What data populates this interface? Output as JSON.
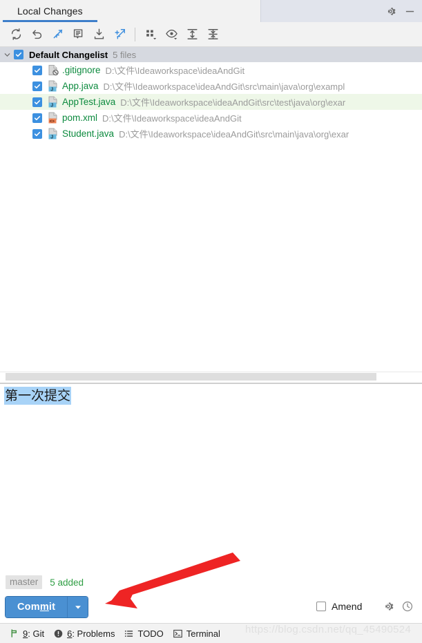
{
  "window": {
    "tab_label": "Local Changes",
    "gear_icon": "gear-icon",
    "minimize_icon": "minimize-icon",
    "accent_color": "#3d7eca"
  },
  "toolbar": {
    "buttons": [
      {
        "name": "refresh-button",
        "icon": "refresh-icon"
      },
      {
        "name": "rollback-button",
        "icon": "undo-arrow-icon"
      },
      {
        "name": "show-diff-button",
        "icon": "diff-arrow-icon"
      },
      {
        "name": "edit-message-button",
        "icon": "comment-icon"
      },
      {
        "name": "shelve-changes-button",
        "icon": "download-tray-icon"
      },
      {
        "name": "unshelve-button",
        "icon": "shelve-arrow-icon"
      },
      {
        "name": "group-by-button",
        "icon": "group-by-icon"
      },
      {
        "name": "preview-diff-button",
        "icon": "eye-icon"
      },
      {
        "name": "expand-all-button",
        "icon": "expand-all-icon"
      },
      {
        "name": "collapse-all-button",
        "icon": "collapse-all-icon"
      }
    ]
  },
  "changelist": {
    "name": "Default Changelist",
    "count_label": "5 files",
    "checked": true,
    "expanded": true
  },
  "files": [
    {
      "name": ".gitignore",
      "path": "D:\\文件\\Ideaworkspace\\ideaAndGit",
      "icon": "ignored-file-icon",
      "checked": true,
      "selected": false,
      "color": "#0c8a3e"
    },
    {
      "name": "App.java",
      "path": "D:\\文件\\Ideaworkspace\\ideaAndGit\\src\\main\\java\\org\\exampl",
      "icon": "java-file-icon",
      "checked": true,
      "selected": false,
      "color": "#0c8a3e"
    },
    {
      "name": "AppTest.java",
      "path": "D:\\文件\\Ideaworkspace\\ideaAndGit\\src\\test\\java\\org\\exar",
      "icon": "java-file-icon",
      "checked": true,
      "selected": true,
      "color": "#0c8a3e"
    },
    {
      "name": "pom.xml",
      "path": "D:\\文件\\Ideaworkspace\\ideaAndGit",
      "icon": "xml-file-icon",
      "checked": true,
      "selected": false,
      "color": "#0c8a3e"
    },
    {
      "name": "Student.java",
      "path": "D:\\文件\\Ideaworkspace\\ideaAndGit\\src\\main\\java\\org\\exar",
      "icon": "java-file-icon",
      "checked": true,
      "selected": false,
      "color": "#0c8a3e"
    }
  ],
  "commit_message": {
    "value": "第一次提交",
    "selected": true,
    "selection_color": "#a8d3f7"
  },
  "commit_bar": {
    "branch": "master",
    "added_label": "5 added",
    "added_color": "#2f9e44",
    "commit_button_label_before": "Com",
    "commit_button_label_mnemonic": "m",
    "commit_button_label_after": "it",
    "commit_button_full_label": "Commit",
    "commit_button_color": "#4a90d2",
    "dropdown_icon": "chevron-down-icon",
    "amend_label": "Amend",
    "amend_checked": false,
    "settings_icon": "gear-icon",
    "history_icon": "clock-icon"
  },
  "statusbar": {
    "items": [
      {
        "name": "status-item-git",
        "icon": "git-branch-icon",
        "num": "9",
        "label": ": Git"
      },
      {
        "name": "status-item-problems",
        "icon": "error-circle-icon",
        "num": "6",
        "label": ": Problems"
      },
      {
        "name": "status-item-todo",
        "icon": "list-icon",
        "num": "",
        "label": "TODO"
      },
      {
        "name": "status-item-terminal",
        "icon": "terminal-icon",
        "num": "",
        "label": "Terminal"
      }
    ]
  },
  "watermark": {
    "text": "https://blog.csdn.net/qq_45490524"
  },
  "annotation": {
    "arrow_color": "#ee2424"
  }
}
